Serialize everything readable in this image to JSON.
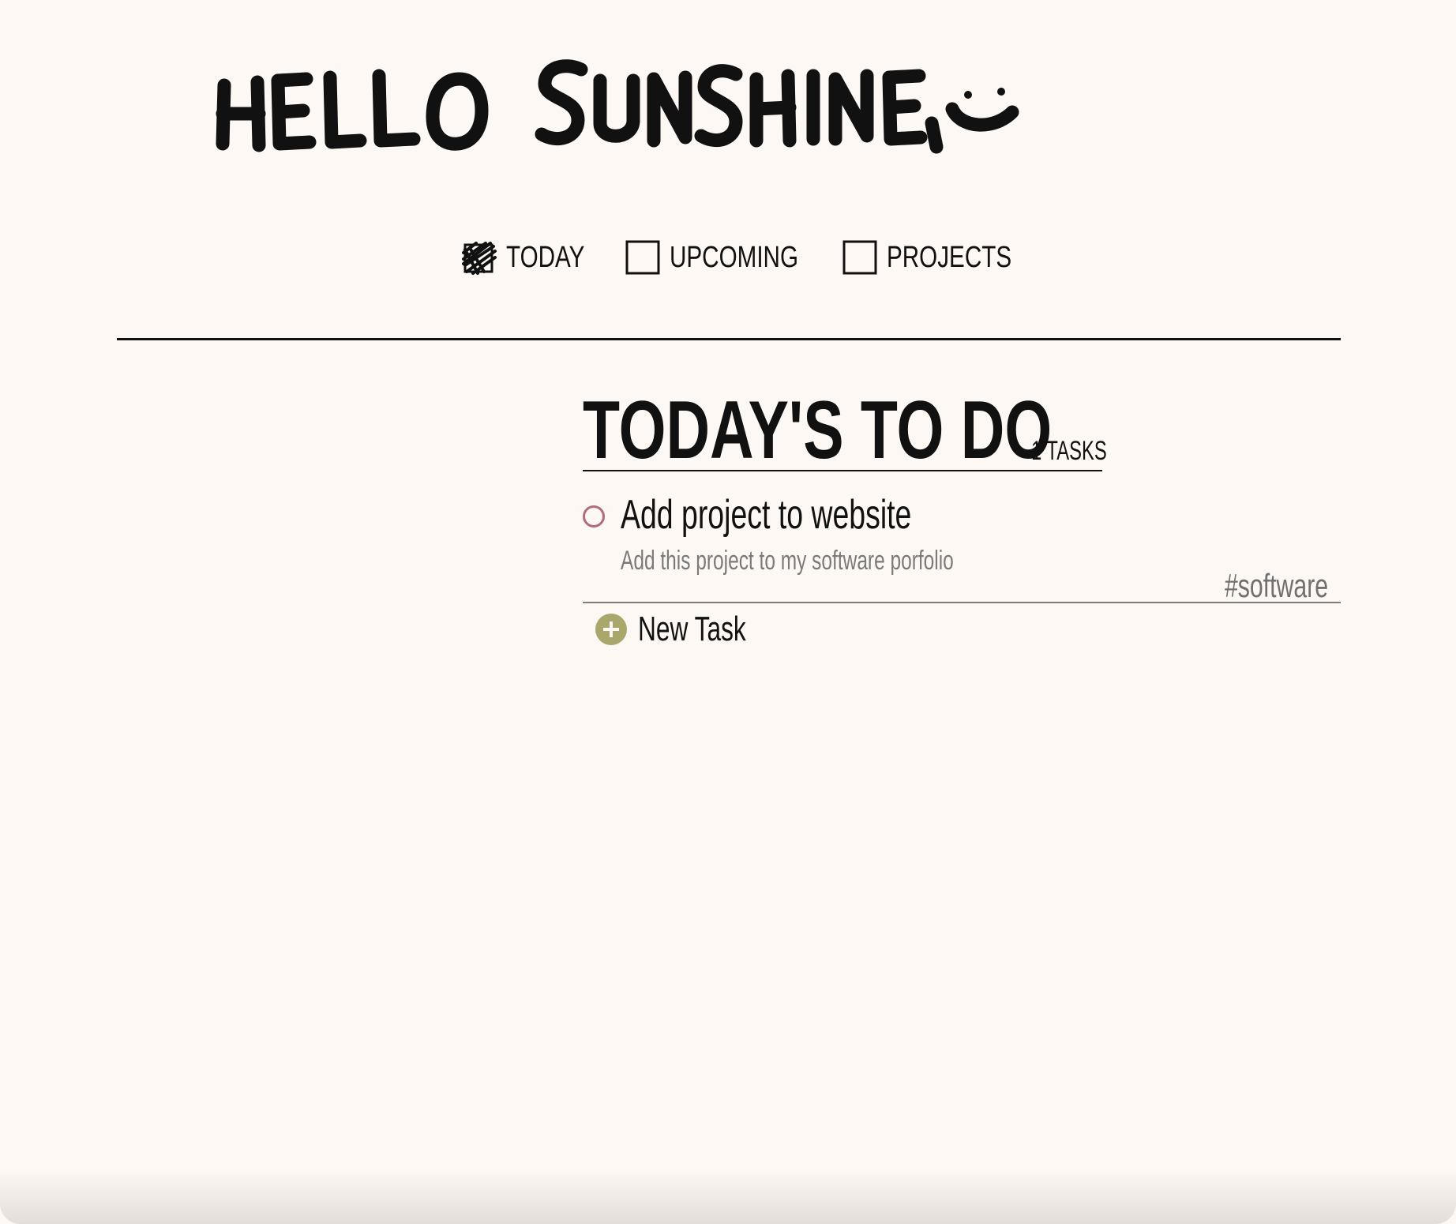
{
  "app": {
    "greeting": "HELLO SUNSHINE,",
    "greeting_icon": "smiley-face-icon"
  },
  "nav": {
    "items": [
      {
        "label": "TODAY",
        "checked": true,
        "icon": "scribbled-checkbox-icon"
      },
      {
        "label": "UPCOMING",
        "checked": false,
        "icon": "empty-checkbox-icon"
      },
      {
        "label": "PROJECTS",
        "checked": false,
        "icon": "empty-checkbox-icon"
      }
    ]
  },
  "main": {
    "title": "TODAY'S TO DO",
    "task_count": "1 TASKS",
    "tasks": [
      {
        "title": "Add project to website",
        "description": "Add this project to my software porfolio",
        "tag": "#software",
        "status_icon": "task-circle-icon"
      }
    ],
    "new_task_label": "New Task",
    "new_task_icon": "plus-circle-icon"
  },
  "colors": {
    "background": "#fdf8f3",
    "text": "#111111",
    "task_circle": "#b06c78",
    "add_button": "#a9a76c",
    "muted_text": "#7a7a7a"
  }
}
